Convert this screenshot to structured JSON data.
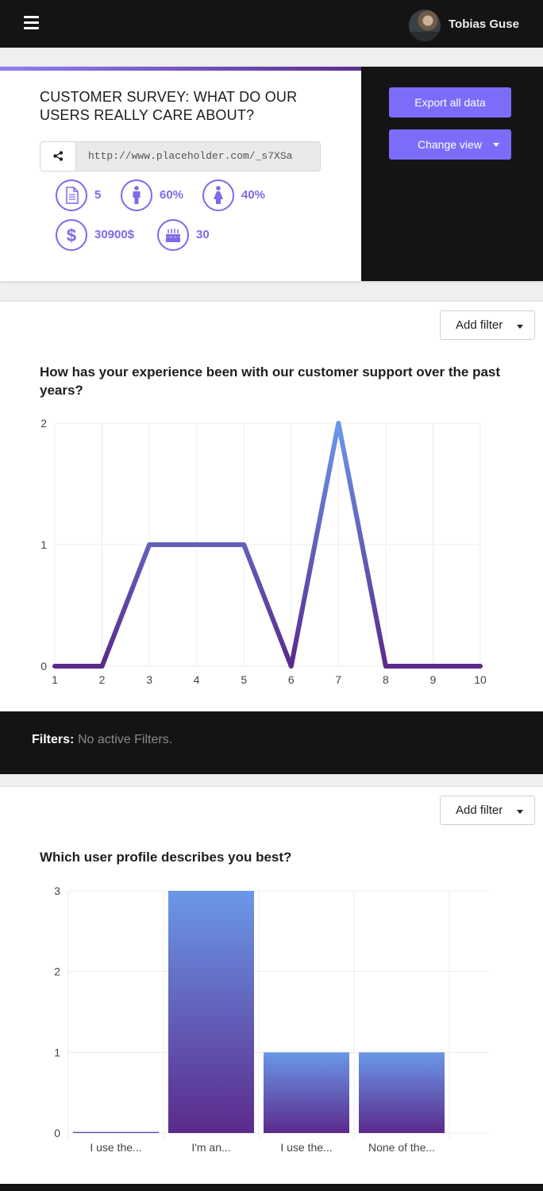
{
  "topbar": {
    "user_name": "Tobias Guse"
  },
  "survey": {
    "title": "CUSTOMER SURVEY: WHAT DO OUR USERS REALLY CARE ABOUT?",
    "share_url": "http://www.placeholder.com/_s7XSa",
    "stats": {
      "responses": "5",
      "male": "60%",
      "female": "40%",
      "income": "30900$",
      "age": "30"
    },
    "export_label": "Export all data",
    "change_view_label": "Change view"
  },
  "questions": [
    {
      "add_filter_label": "Add filter",
      "title": "How has your experience been with our customer support over the past years?",
      "filters_label": "Filters:",
      "filters_value": "No active Filters."
    },
    {
      "add_filter_label": "Add filter",
      "title": "Which user profile describes you best?"
    }
  ],
  "colors": {
    "accent": "#7b6dfa",
    "gradient_top": "#6a98e8",
    "gradient_bottom": "#5b2a8c",
    "dark": "#141414"
  },
  "chart_data": [
    {
      "type": "line",
      "x": [
        1,
        2,
        3,
        4,
        5,
        6,
        7,
        8,
        9,
        10
      ],
      "values": [
        0,
        0,
        1,
        1,
        1,
        0,
        2,
        0,
        0,
        0
      ],
      "xlim": [
        1,
        10
      ],
      "ylim": [
        0,
        2
      ],
      "y_ticks": [
        0,
        1,
        2
      ],
      "grid": true
    },
    {
      "type": "bar",
      "categories": [
        "I use the...",
        "I'm an...",
        "I use the...",
        "None of the..."
      ],
      "values": [
        0,
        3,
        1,
        1
      ],
      "ylim": [
        0,
        3
      ],
      "y_ticks": [
        0,
        1,
        2,
        3
      ],
      "grid": true
    }
  ]
}
